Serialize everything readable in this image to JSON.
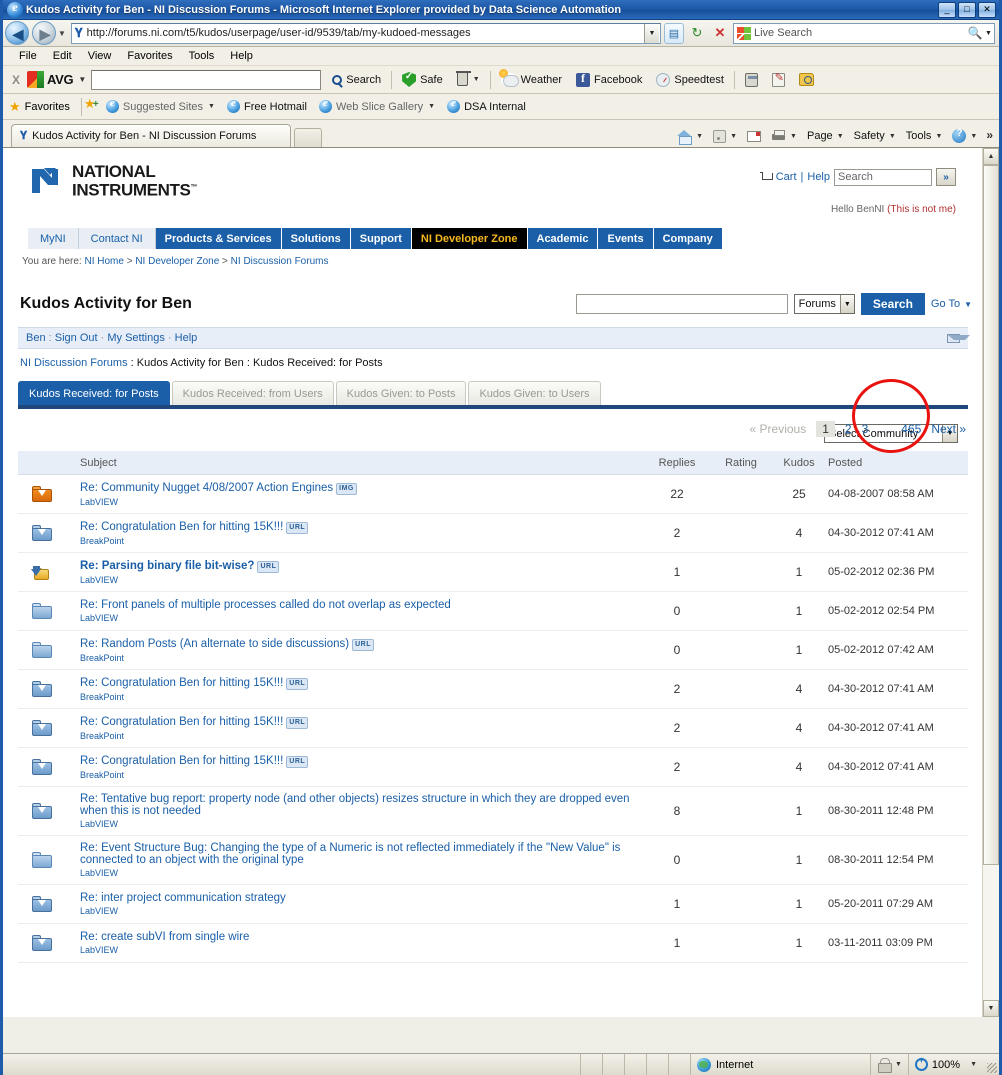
{
  "window": {
    "title": "Kudos Activity for Ben - NI Discussion Forums - Microsoft Internet Explorer provided by Data Science Automation",
    "minimize": "_",
    "maximize": "□",
    "close": "✕"
  },
  "address_bar": {
    "url": "http://forums.ni.com/t5/kudos/userpage/user-id/9539/tab/my-kudoed-messages",
    "search_placeholder": "Live Search"
  },
  "menu": [
    {
      "label": "File"
    },
    {
      "label": "Edit"
    },
    {
      "label": "View"
    },
    {
      "label": "Favorites"
    },
    {
      "label": "Tools"
    },
    {
      "label": "Help"
    }
  ],
  "avg_toolbar": {
    "close": "X",
    "brand": "AVG",
    "search_value": "",
    "items": [
      {
        "label": "Search",
        "icon": "search-icon"
      },
      {
        "label": "Safe",
        "icon": "shield-icon"
      },
      {
        "label": "",
        "icon": "trash-icon"
      },
      {
        "label": "Weather",
        "icon": "weather-icon"
      },
      {
        "label": "Facebook",
        "icon": "facebook-icon"
      },
      {
        "label": "Speedtest",
        "icon": "speedtest-icon"
      }
    ]
  },
  "favorites_bar": {
    "label": "Favorites",
    "items": [
      {
        "label": "Suggested Sites",
        "dropdown": true
      },
      {
        "label": "Free Hotmail",
        "dropdown": false
      },
      {
        "label": "Web Slice Gallery",
        "dropdown": true
      },
      {
        "label": "DSA Internal",
        "dropdown": false
      }
    ]
  },
  "browser_tabs": [
    {
      "label": "Kudos Activity for Ben - NI Discussion Forums",
      "active": true
    }
  ],
  "command_bar": [
    {
      "label": "",
      "icon": "home-icon"
    },
    {
      "label": "",
      "icon": "rss-icon"
    },
    {
      "label": "",
      "icon": "mail-icon"
    },
    {
      "label": "",
      "icon": "print-icon"
    },
    {
      "label": "Page",
      "icon": ""
    },
    {
      "label": "Safety",
      "icon": ""
    },
    {
      "label": "Tools",
      "icon": ""
    },
    {
      "label": "",
      "icon": "help-icon"
    }
  ],
  "ni_header": {
    "logo_line1": "NATIONAL",
    "logo_line2": "INSTRUMENTS",
    "cart": "Cart",
    "divider": "|",
    "help": "Help",
    "search_placeholder": "Search",
    "go_label": "»",
    "hello_text": "Hello BenNI",
    "hello_link": "(This is not me)"
  },
  "ni_nav": {
    "left_items": [
      {
        "label": "MyNI"
      },
      {
        "label": "Contact NI"
      }
    ],
    "items": [
      {
        "label": "Products & Services",
        "active": false
      },
      {
        "label": "Solutions",
        "active": false
      },
      {
        "label": "Support",
        "active": false
      },
      {
        "label": "NI Developer Zone",
        "active": true
      },
      {
        "label": "Academic",
        "active": false
      },
      {
        "label": "Events",
        "active": false
      },
      {
        "label": "Company",
        "active": false
      }
    ]
  },
  "breadcrumb_top": {
    "prefix": "You are here:",
    "items": [
      "NI Home",
      "NI Developer Zone",
      "NI Discussion Forums"
    ],
    "separator": ">"
  },
  "select_community": {
    "value": "Select Community"
  },
  "page": {
    "title": "Kudos Activity for Ben",
    "search_value": "",
    "search_scope": "Forums",
    "search_button": "Search",
    "goto_label": "Go To"
  },
  "user_bar": {
    "items": [
      "Ben",
      "Sign Out",
      "My Settings",
      "Help"
    ],
    "separator": ":"
  },
  "breadcrumb_page": {
    "root": "NI Discussion Forums",
    "sep": ":",
    "mid": "Kudos Activity for Ben",
    "current": "Kudos Received: for Posts"
  },
  "kudos_tabs": [
    {
      "label": "Kudos Received: for Posts",
      "active": true
    },
    {
      "label": "Kudos Received: from Users",
      "active": false
    },
    {
      "label": "Kudos Given: to Posts",
      "active": false
    },
    {
      "label": "Kudos Given: to Users",
      "active": false
    }
  ],
  "pager": {
    "previous": "« Previous",
    "pages": [
      "1",
      "2",
      "3"
    ],
    "current_page": "1",
    "ellipsis": "…",
    "last_page": "465",
    "next": "Next »",
    "annotation_color": "#e8130f",
    "annotation_target": "465"
  },
  "table": {
    "headers": {
      "subject": "Subject",
      "replies": "Replies",
      "rating": "Rating",
      "kudos": "Kudos",
      "posted": "Posted"
    },
    "rows": [
      {
        "icon": "message-folder-orange-icon",
        "subject": "Re: Community Nugget 4/08/2007 Action Engines",
        "badge": "IMG",
        "bold": false,
        "board": "LabVIEW",
        "replies": "22",
        "rating": "",
        "kudos": "25",
        "posted": "04-08-2007 08:58 AM"
      },
      {
        "icon": "message-folder-blue-icon",
        "subject": "Re: Congratulation Ben for hitting 15K!!!",
        "badge": "URL",
        "bold": false,
        "board": "BreakPoint",
        "replies": "2",
        "rating": "",
        "kudos": "4",
        "posted": "04-30-2012 07:41 AM"
      },
      {
        "icon": "message-reply-gold-icon",
        "subject": "Re: Parsing binary file bit-wise?",
        "badge": "URL",
        "bold": true,
        "board": "LabVIEW",
        "replies": "1",
        "rating": "",
        "kudos": "1",
        "posted": "05-02-2012 02:36 PM"
      },
      {
        "icon": "message-folder-plain-icon",
        "subject": "Re: Front panels of multiple processes called do not overlap as expected",
        "badge": "",
        "bold": false,
        "board": "LabVIEW",
        "replies": "0",
        "rating": "",
        "kudos": "1",
        "posted": "05-02-2012 02:54 PM"
      },
      {
        "icon": "message-folder-plain-icon",
        "subject": "Re: Random Posts (An alternate to side discussions)",
        "badge": "URL",
        "bold": false,
        "board": "BreakPoint",
        "replies": "0",
        "rating": "",
        "kudos": "1",
        "posted": "05-02-2012 07:42 AM"
      },
      {
        "icon": "message-folder-blue-icon",
        "subject": "Re: Congratulation Ben for hitting 15K!!!",
        "badge": "URL",
        "bold": false,
        "board": "BreakPoint",
        "replies": "2",
        "rating": "",
        "kudos": "4",
        "posted": "04-30-2012 07:41 AM"
      },
      {
        "icon": "message-folder-blue-icon",
        "subject": "Re: Congratulation Ben for hitting 15K!!!",
        "badge": "URL",
        "bold": false,
        "board": "BreakPoint",
        "replies": "2",
        "rating": "",
        "kudos": "4",
        "posted": "04-30-2012 07:41 AM"
      },
      {
        "icon": "message-folder-blue-icon",
        "subject": "Re: Congratulation Ben for hitting 15K!!!",
        "badge": "URL",
        "bold": false,
        "board": "BreakPoint",
        "replies": "2",
        "rating": "",
        "kudos": "4",
        "posted": "04-30-2012 07:41 AM"
      },
      {
        "icon": "message-folder-blue-icon",
        "subject": "Re: Tentative bug report: property node (and other objects) resizes structure in which they are dropped even when this is not needed",
        "badge": "",
        "bold": false,
        "board": "LabVIEW",
        "replies": "8",
        "rating": "",
        "kudos": "1",
        "posted": "08-30-2011 12:48 PM"
      },
      {
        "icon": "message-folder-plain-icon",
        "subject": "Re: Event Structure Bug: Changing the type of a Numeric is not reflected immediately if the \"New Value\" is connected to an object with the original type",
        "badge": "",
        "bold": false,
        "board": "LabVIEW",
        "replies": "0",
        "rating": "",
        "kudos": "1",
        "posted": "08-30-2011 12:54 PM"
      },
      {
        "icon": "message-folder-blue-icon",
        "subject": "Re: inter project communication strategy",
        "badge": "",
        "bold": false,
        "board": "LabVIEW",
        "replies": "1",
        "rating": "",
        "kudos": "1",
        "posted": "05-20-2011 07:29 AM"
      },
      {
        "icon": "message-folder-blue-icon",
        "subject": "Re: create subVI from single wire",
        "badge": "",
        "bold": false,
        "board": "LabVIEW",
        "replies": "1",
        "rating": "",
        "kudos": "1",
        "posted": "03-11-2011 03:09 PM"
      }
    ]
  },
  "status_bar": {
    "message": "",
    "zone": "Internet",
    "zoom": "100%"
  }
}
